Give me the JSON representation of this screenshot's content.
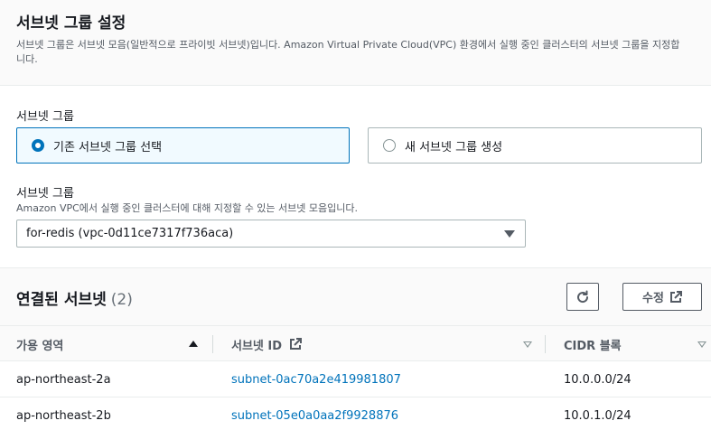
{
  "header": {
    "title": "서브넷 그룹 설정",
    "description": "서브넷 그룹은 서브넷 모음(일반적으로 프라이빗 서브넷)입니다. Amazon Virtual Private Cloud(VPC) 환경에서 실행 중인 클러스터의 서브넷 그룹을 지정합니다."
  },
  "subnet_group": {
    "label": "서브넷 그룹",
    "options": [
      {
        "label": "기존 서브넷 그룹 선택",
        "selected": true
      },
      {
        "label": "새 서브넷 그룹 생성",
        "selected": false
      }
    ],
    "select_label": "서브넷 그룹",
    "select_description": "Amazon VPC에서 실행 중인 클러스터에 대해 지정할 수 있는 서브넷 모음입니다.",
    "selected_value": "for-redis (vpc-0d11ce7317f736aca)"
  },
  "subnets_table": {
    "title": "연결된 서브넷",
    "count": "(2)",
    "edit_label": "수정",
    "columns": [
      "가용 영역",
      "서브넷 ID",
      "CIDR 블록"
    ],
    "rows": [
      {
        "az": "ap-northeast-2a",
        "subnet_id": "subnet-0ac70a2e419981807",
        "cidr": "10.0.0.0/24"
      },
      {
        "az": "ap-northeast-2b",
        "subnet_id": "subnet-05e0a0aa2f9928876",
        "cidr": "10.0.1.0/24"
      }
    ]
  },
  "colors": {
    "accent": "#0073bb",
    "text": "#16191f",
    "muted": "#545b64"
  }
}
